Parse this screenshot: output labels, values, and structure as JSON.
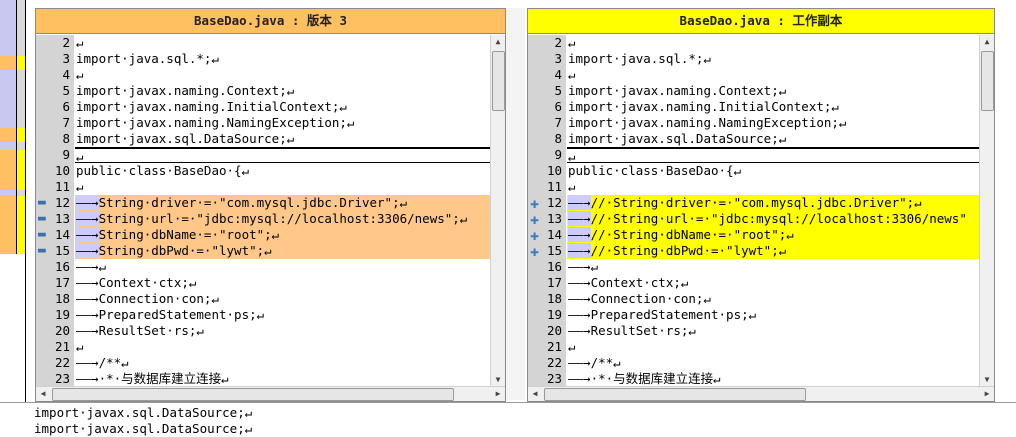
{
  "left_pane": {
    "title": "BaseDao.java : 版本 3",
    "lines": [
      {
        "num": "2",
        "text": "↵",
        "type": "normal"
      },
      {
        "num": "3",
        "text": "import·java.sql.*;↵",
        "type": "normal"
      },
      {
        "num": "4",
        "text": "↵",
        "type": "normal"
      },
      {
        "num": "5",
        "text": "import·javax.naming.Context;↵",
        "type": "normal"
      },
      {
        "num": "6",
        "text": "import·javax.naming.InitialContext;↵",
        "type": "normal"
      },
      {
        "num": "7",
        "text": "import·javax.naming.NamingException;↵",
        "type": "normal"
      },
      {
        "num": "8",
        "text": "import·javax.sql.DataSource;↵",
        "type": "normal"
      },
      {
        "num": "9",
        "text": "↵",
        "type": "sep"
      },
      {
        "num": "10",
        "text": "public·class·BaseDao·{↵",
        "type": "normal"
      },
      {
        "num": "11",
        "text": "↵",
        "type": "normal"
      },
      {
        "num": "12",
        "lead": "——→",
        "text": "String·driver·=·\"com.mysql.jdbc.Driver\";↵",
        "type": "changed"
      },
      {
        "num": "13",
        "lead": "——→",
        "text": "String·url·=·\"jdbc:mysql://localhost:3306/news\";↵",
        "type": "changed"
      },
      {
        "num": "14",
        "lead": "——→",
        "text": "String·dbName·=·\"root\";↵",
        "type": "changed"
      },
      {
        "num": "15",
        "lead": "——→",
        "text": "String·dbPwd·=·\"lywt\";↵",
        "type": "changed"
      },
      {
        "num": "16",
        "text": "——→↵",
        "type": "normal"
      },
      {
        "num": "17",
        "text": "——→Context·ctx;↵",
        "type": "normal"
      },
      {
        "num": "18",
        "text": "——→Connection·con;↵",
        "type": "normal"
      },
      {
        "num": "19",
        "text": "——→PreparedStatement·ps;↵",
        "type": "normal"
      },
      {
        "num": "20",
        "text": "——→ResultSet·rs;↵",
        "type": "normal"
      },
      {
        "num": "21",
        "text": "↵",
        "type": "normal"
      },
      {
        "num": "22",
        "text": "——→/**↵",
        "type": "normal"
      },
      {
        "num": "23",
        "text": "——→·*·与数据库建立连接↵",
        "type": "normal"
      }
    ]
  },
  "right_pane": {
    "title": "BaseDao.java : 工作副本",
    "lines": [
      {
        "num": "2",
        "text": "↵",
        "type": "normal"
      },
      {
        "num": "3",
        "text": "import·java.sql.*;↵",
        "type": "normal"
      },
      {
        "num": "4",
        "text": "↵",
        "type": "normal"
      },
      {
        "num": "5",
        "text": "import·javax.naming.Context;↵",
        "type": "normal"
      },
      {
        "num": "6",
        "text": "import·javax.naming.InitialContext;↵",
        "type": "normal"
      },
      {
        "num": "7",
        "text": "import·javax.naming.NamingException;↵",
        "type": "normal"
      },
      {
        "num": "8",
        "text": "import·javax.sql.DataSource;↵",
        "type": "normal"
      },
      {
        "num": "9",
        "text": "↵",
        "type": "sep"
      },
      {
        "num": "10",
        "text": "public·class·BaseDao·{↵",
        "type": "normal"
      },
      {
        "num": "11",
        "text": "↵",
        "type": "normal"
      },
      {
        "num": "12",
        "lead": "——→",
        "text": "//·String·driver·=·\"com.mysql.jdbc.Driver\";↵",
        "type": "changed"
      },
      {
        "num": "13",
        "lead": "——→",
        "text": "//·String·url·=·\"jdbc:mysql://localhost:3306/news\"",
        "type": "changed"
      },
      {
        "num": "14",
        "lead": "——→",
        "text": "//·String·dbName·=·\"root\";↵",
        "type": "changed"
      },
      {
        "num": "15",
        "lead": "——→",
        "text": "//·String·dbPwd·=·\"lywt\";↵",
        "type": "changed"
      },
      {
        "num": "16",
        "text": "——→↵",
        "type": "normal"
      },
      {
        "num": "17",
        "text": "——→Context·ctx;↵",
        "type": "normal"
      },
      {
        "num": "18",
        "text": "——→Connection·con;↵",
        "type": "normal"
      },
      {
        "num": "19",
        "text": "——→PreparedStatement·ps;↵",
        "type": "normal"
      },
      {
        "num": "20",
        "text": "——→ResultSet·rs;↵",
        "type": "normal"
      },
      {
        "num": "21",
        "text": "↵",
        "type": "normal"
      },
      {
        "num": "22",
        "text": "——→/**↵",
        "type": "normal"
      },
      {
        "num": "23",
        "text": "——→·*·与数据库建立连接↵",
        "type": "normal"
      }
    ]
  },
  "bottom_lines": [
    "import·javax.sql.DataSource;↵",
    "import·javax.sql.DataSource;↵"
  ],
  "markers": {
    "left": "minus-icon",
    "right": "plus-icon",
    "left_glyph": "▬",
    "right_glyph": "✚"
  },
  "colors": {
    "left_header": "#ffc061",
    "right_header": "#ffff00",
    "left_change": "#ffc888",
    "right_change": "#ffff00",
    "gutter": "#d4d4d4"
  }
}
